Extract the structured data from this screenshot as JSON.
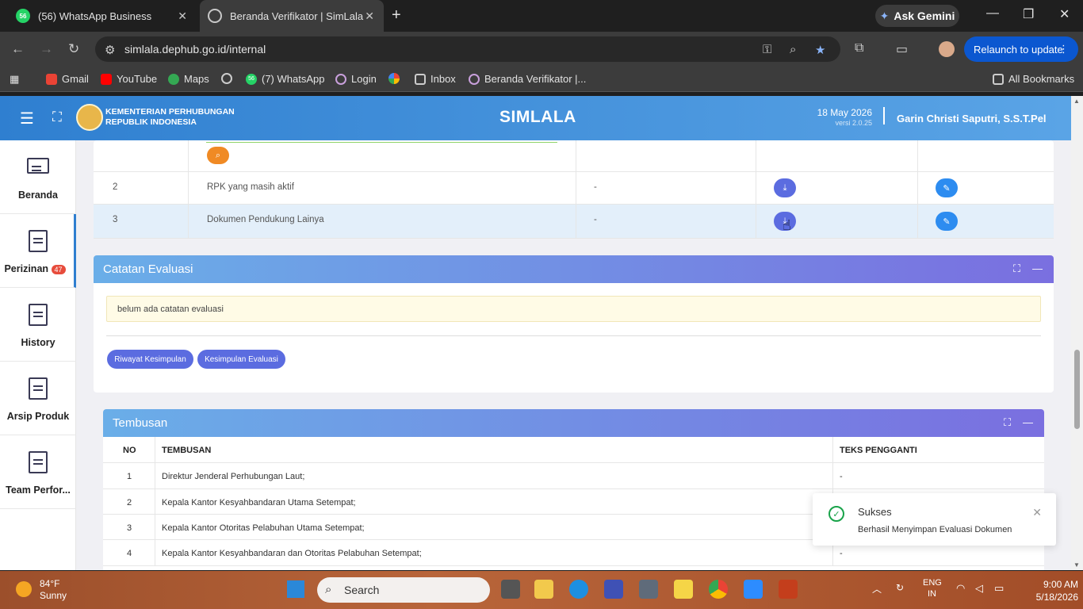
{
  "browser": {
    "tabs": [
      {
        "label": "(56) WhatsApp Business",
        "icon": "whatsapp-icon",
        "badge": "56"
      },
      {
        "label": "Beranda Verifikator | SimLala",
        "icon": "globe-icon"
      }
    ],
    "gemini": "Ask Gemini",
    "url": "simlala.dephub.go.id/internal",
    "relaunch": "Relaunch to update",
    "bookmarks": [
      "Gmail",
      "YouTube",
      "Maps",
      "(7) WhatsApp",
      "Login",
      "Inbox",
      "Beranda Verifikator |..."
    ],
    "bookmark_badge": "56",
    "all_bookmarks": "All Bookmarks"
  },
  "header": {
    "ministry_line1": "KEMENTERIAN PERHUBUNGAN",
    "ministry_line2": "REPUBLIK INDONESIA",
    "app_title": "SIMLALA",
    "date": "18 May 2026",
    "version": "versi 2.0.25",
    "user": "Garin Christi Saputri, S.S.T.Pel"
  },
  "sidebar": {
    "items": [
      {
        "label": "Beranda"
      },
      {
        "label": "Perizinan",
        "badge": "47"
      },
      {
        "label": "History"
      },
      {
        "label": "Arsip Produk"
      },
      {
        "label": "Team Perfor..."
      }
    ]
  },
  "documents": {
    "rows": [
      {
        "no": "2",
        "name": "RPK yang masih aktif",
        "note": "-"
      },
      {
        "no": "3",
        "name": "Dokumen Pendukung Lainya",
        "note": "-"
      }
    ]
  },
  "catatan": {
    "title": "Catatan Evaluasi",
    "note": "belum ada catatan evaluasi",
    "btn_riwayat": "Riwayat Kesimpulan",
    "btn_kesimpulan": "Kesimpulan Evaluasi"
  },
  "tembusan": {
    "title": "Tembusan",
    "headers": [
      "NO",
      "TEMBUSAN",
      "TEKS PENGGANTI"
    ],
    "rows": [
      {
        "no": "1",
        "name": "Direktur Jenderal Perhubungan Laut;",
        "alt": "-"
      },
      {
        "no": "2",
        "name": "Kepala Kantor Kesyahbandaran Utama Setempat;",
        "alt": ""
      },
      {
        "no": "3",
        "name": "Kepala Kantor Otoritas Pelabuhan Utama Setempat;",
        "alt": ""
      },
      {
        "no": "4",
        "name": "Kepala Kantor Kesyahbandaran dan Otoritas Pelabuhan Setempat;",
        "alt": "-"
      }
    ]
  },
  "toast": {
    "title": "Sukses",
    "message": "Berhasil Menyimpan Evaluasi Dokumen"
  },
  "taskbar": {
    "temp": "84°F",
    "weather": "Sunny",
    "search": "Search",
    "lang1": "ENG",
    "lang2": "IN",
    "time": "9:00 AM",
    "date": "5/18/2026"
  },
  "colors": {
    "accent": "#5b6ce0",
    "header_blue": "#2f7fd0",
    "success": "#19a34a",
    "orange": "#f08a24"
  }
}
